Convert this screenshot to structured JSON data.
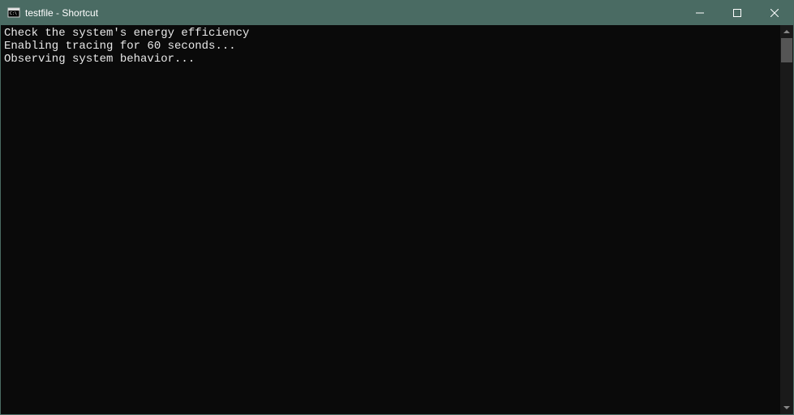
{
  "window": {
    "title": "testfile - Shortcut"
  },
  "terminal": {
    "lines": [
      "Check the system's energy efficiency",
      "Enabling tracing for 60 seconds...",
      "Observing system behavior..."
    ]
  }
}
